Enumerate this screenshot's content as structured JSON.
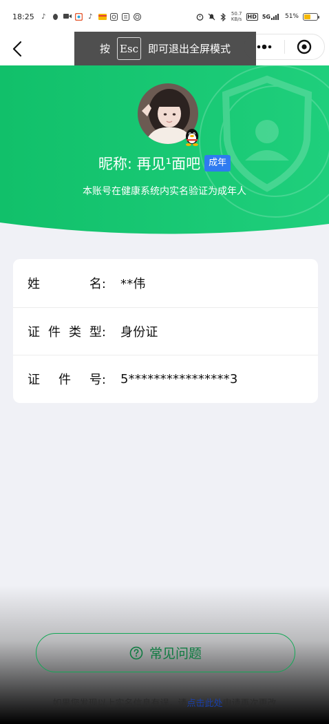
{
  "status_bar": {
    "time": "18:25",
    "network_speed_top": "50.7",
    "network_speed_bottom": "KB/s",
    "hd_label": "HD",
    "signal_label": "5G",
    "battery_percent": "51%",
    "battery_level": 0.51
  },
  "esc_toast": {
    "prefix": "按",
    "key": "Esc",
    "suffix": "即可退出全屏模式"
  },
  "profile": {
    "nickname": "昵称: 再见¹面吧",
    "adult_badge": "成年",
    "verification_text": "本账号在健康系统内实名验证为成年人"
  },
  "info": {
    "rows": [
      {
        "label_chars": [
          "姓",
          "名:"
        ],
        "value": "**伟"
      },
      {
        "label_chars": [
          "证",
          "件",
          "类",
          "型:"
        ],
        "value": "身份证"
      },
      {
        "label_chars": [
          "证",
          "件",
          "号:"
        ],
        "value": "5****************3"
      }
    ]
  },
  "faq": {
    "label": "常见问题"
  },
  "footer": {
    "prefix": "如果您发现以上实名信息有误，请",
    "link": "点击此处",
    "suffix": "申请再次更改"
  },
  "colors": {
    "brand_green": "#12c36a",
    "badge_blue": "#2f7bf0",
    "page_bg": "#f0f1f6"
  }
}
